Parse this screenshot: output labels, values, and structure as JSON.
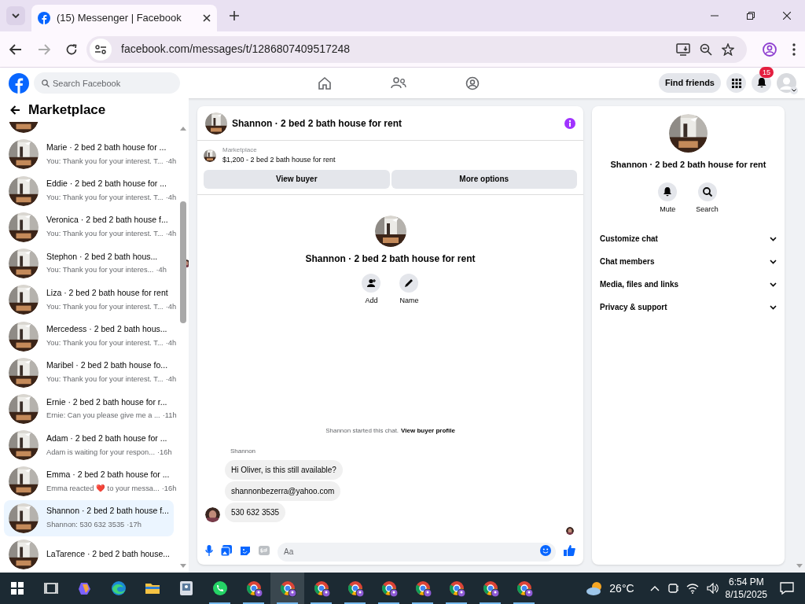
{
  "browser": {
    "tab_title": "(15) Messenger | Facebook",
    "url": "facebook.com/messages/t/1286807409517248"
  },
  "header": {
    "search_placeholder": "Search Facebook",
    "find_friends": "Find friends",
    "notification_count": "15"
  },
  "sidebar": {
    "title": "Marketplace",
    "conversations": [
      {
        "title": "Marie · 2 bed 2 bath house for ...",
        "preview": "You: Thank you for your interest. T...",
        "time": "·4h",
        "selected": false,
        "seen": false
      },
      {
        "title": "Eddie · 2 bed 2 bath house for ...",
        "preview": "You: Thank you for your interest. T...",
        "time": "·4h",
        "selected": false,
        "seen": false
      },
      {
        "title": "Veronica · 2 bed 2 bath house f...",
        "preview": "You: Thank you for your interest. T...",
        "time": "·4h",
        "selected": false,
        "seen": false
      },
      {
        "title": "Stephon · 2 bed 2 bath hous...",
        "preview": "You: Thank you for your interes...",
        "time": "·4h",
        "selected": false,
        "seen": true
      },
      {
        "title": "Liza · 2 bed 2 bath house for rent",
        "preview": "You: Thank you for your interest. T...",
        "time": "·4h",
        "selected": false,
        "seen": false
      },
      {
        "title": "Mercedess · 2 bed 2 bath hous...",
        "preview": "You: Thank you for your interest. T...",
        "time": "·4h",
        "selected": false,
        "seen": false
      },
      {
        "title": "Maribel · 2 bed 2 bath house fo...",
        "preview": "You: Thank you for your interest. T...",
        "time": "·4h",
        "selected": false,
        "seen": false
      },
      {
        "title": "Ernie · 2 bed 2 bath house for r...",
        "preview": "Ernie: Can you please give me a ...",
        "time": "·11h",
        "selected": false,
        "seen": false
      },
      {
        "title": "Adam · 2 bed 2 bath house for ...",
        "preview": "Adam is waiting for your respon...",
        "time": "·16h",
        "selected": false,
        "seen": false
      },
      {
        "title": "Emma · 2 bed 2 bath house for ...",
        "preview": "Emma reacted ❤️ to your messa...",
        "time": "·16h",
        "selected": false,
        "seen": false
      },
      {
        "title": "Shannon · 2 bed 2 bath house f...",
        "preview": "Shannon: 530 632 3535",
        "time": "·17h",
        "selected": true,
        "seen": false
      },
      {
        "title": "LaTarence · 2 bed 2 bath house...",
        "selected": false,
        "seen": false
      }
    ]
  },
  "chat": {
    "title": "Shannon · 2 bed 2 bath house for rent",
    "listing_label": "Marketplace",
    "listing": "$1,200 - 2 bed 2 bath house for rent",
    "buttons": [
      "View buyer",
      "More options"
    ],
    "intro_title": "Shannon · 2 bed 2 bath house for rent",
    "intro_actions": [
      {
        "kind": "add",
        "label": "Add"
      },
      {
        "kind": "name",
        "label": "Name"
      }
    ],
    "notice": "Shannon started this chat.",
    "notice_link": "View buyer profile",
    "sender": "Shannon",
    "messages": [
      "Hi Oliver, is this still available?",
      "shannonbezerra@yahoo.com",
      "530 632 3535"
    ],
    "composer_placeholder": "Aa"
  },
  "details": {
    "title": "Shannon · 2 bed 2 bath house for rent",
    "actions": [
      {
        "kind": "mute",
        "label": "Mute"
      },
      {
        "kind": "search",
        "label": "Search"
      }
    ],
    "sections": [
      "Customize chat",
      "Chat members",
      "Media, files and links",
      "Privacy & support"
    ]
  },
  "taskbar": {
    "apps": [
      {
        "kind": "start",
        "running": false,
        "selected": false
      },
      {
        "kind": "taskview",
        "running": false,
        "selected": false
      },
      {
        "kind": "copilot",
        "running": false,
        "selected": false
      },
      {
        "kind": "edge",
        "running": false,
        "selected": false
      },
      {
        "kind": "explorer",
        "running": false,
        "selected": false
      },
      {
        "kind": "app",
        "running": false,
        "selected": false
      },
      {
        "kind": "whatsapp",
        "running": true,
        "selected": false
      },
      {
        "kind": "chrome",
        "running": true,
        "selected": false
      },
      {
        "kind": "chrome",
        "running": true,
        "selected": true
      },
      {
        "kind": "chrome",
        "running": true,
        "selected": false
      },
      {
        "kind": "chrome",
        "running": true,
        "selected": false
      },
      {
        "kind": "chrome",
        "running": true,
        "selected": false
      },
      {
        "kind": "chrome",
        "running": true,
        "selected": false
      },
      {
        "kind": "chrome",
        "running": true,
        "selected": false
      },
      {
        "kind": "chrome",
        "running": true,
        "selected": false
      },
      {
        "kind": "chrome",
        "running": true,
        "selected": false
      }
    ],
    "temperature": "26°C",
    "time": "6:54 PM",
    "date": "8/15/2025"
  }
}
